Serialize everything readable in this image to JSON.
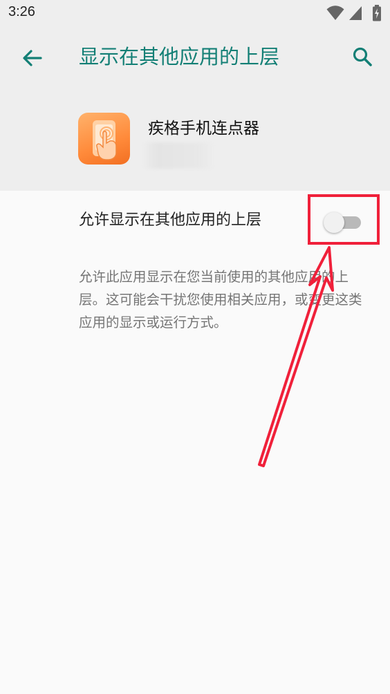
{
  "status_bar": {
    "time": "3:26",
    "icons": [
      "wifi-icon",
      "signal-icon",
      "battery-icon"
    ]
  },
  "app_bar": {
    "title": "显示在其他应用的上层",
    "back_icon": "arrow-back-icon",
    "search_icon": "search-icon",
    "accent_color": "#137f75"
  },
  "app": {
    "name": "疾格手机连点器",
    "icon": "app-icon"
  },
  "setting": {
    "label": "允许显示在其他应用的上层",
    "enabled": false
  },
  "description": "允许此应用显示在您当前使用的其他应用的上层。这可能会干扰您使用相关应用，或变更这类应用的显示或运行方式。",
  "annotation": {
    "highlight_color": "#f0203a",
    "shapes": [
      "highlight-box",
      "arrow"
    ]
  }
}
